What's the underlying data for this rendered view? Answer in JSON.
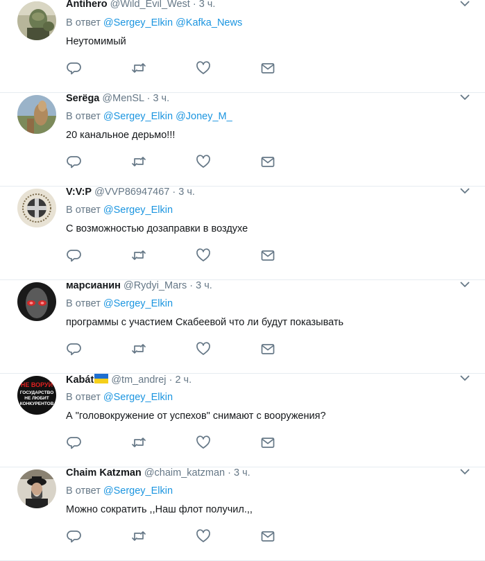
{
  "reply_prefix": "В ответ",
  "dot": "·",
  "colors": {
    "name": "#14171a",
    "secondary": "#657786",
    "link": "#1b95e0",
    "divider": "#e6ecf0",
    "icon": "#657786"
  },
  "tweets": [
    {
      "name": "Antihero",
      "handle": "@Wild_Evil_West",
      "time": "3 ч.",
      "mentions": [
        "@Sergey_Elkin",
        "@Kafka_News"
      ],
      "text": "Неутомимый"
    },
    {
      "name": "Serёga",
      "handle": "@MenSL",
      "time": "3 ч.",
      "mentions": [
        "@Sergey_Elkin",
        "@Joney_M_"
      ],
      "text": "20 канальное дерьмо!!!"
    },
    {
      "name": "V:V:P",
      "handle": "@VVP86947467",
      "time": "3 ч.",
      "mentions": [
        "@Sergey_Elkin"
      ],
      "text": "С возможностью дозаправки в воздухе"
    },
    {
      "name": "марсианин",
      "handle": "@Rydyi_Mars",
      "time": "3 ч.",
      "mentions": [
        "@Sergey_Elkin"
      ],
      "text": "программы с участием Скабеевой что ли будут показывать"
    },
    {
      "name": "Kabát",
      "handle": "@tm_andrej",
      "time": "2 ч.",
      "mentions": [
        "@Sergey_Elkin"
      ],
      "text": "А \"головокружение от успехов\" снимают с вооружения?",
      "avatar_text": [
        "НЕ ВОРУЙ",
        "ГОСУДАРСТВО",
        "НЕ ЛЮБИТ",
        "КОНКУРЕНТОВ"
      ]
    },
    {
      "name": "Chaim Katzman",
      "handle": "@chaim_katzman",
      "time": "3 ч.",
      "mentions": [
        "@Sergey_Elkin"
      ],
      "text": "Можно сократить ,,Наш флот получил.,,"
    }
  ],
  "icons": {
    "reply": "reply-icon",
    "retweet": "retweet-icon",
    "like": "heart-icon",
    "dm": "envelope-icon",
    "more": "chevron-down-icon",
    "flag": "ukraine-flag-icon"
  }
}
